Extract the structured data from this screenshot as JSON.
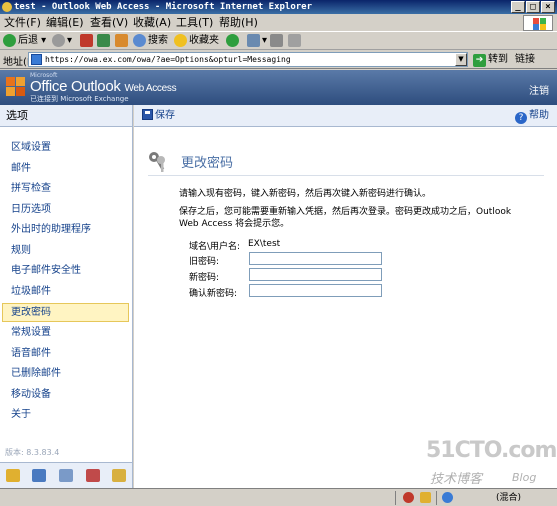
{
  "window": {
    "title": "test - Outlook Web Access - Microsoft Internet Explorer",
    "controls": [
      "_",
      "□",
      "×"
    ]
  },
  "menu": {
    "items": [
      "文件(F)",
      "编辑(E)",
      "查看(V)",
      "收藏(A)",
      "工具(T)",
      "帮助(H)"
    ]
  },
  "toolbar": {
    "back": "后退",
    "search": "搜索",
    "favorites": "收藏夹"
  },
  "address": {
    "label": "地址(D)",
    "url": "https://owa.ex.com/owa/?ae=Options&opturl=Messaging",
    "go": "转到",
    "links": "链接"
  },
  "owa": {
    "brand_small": "Microsoft",
    "brand_main": "Office Outlook",
    "brand_suffix": "Web Access",
    "connected": "已连接到 Microsoft Exchange",
    "logout": "注销"
  },
  "nav": {
    "header": "选项",
    "items": [
      {
        "label": "区域设置"
      },
      {
        "label": "邮件"
      },
      {
        "label": "拼写检查"
      },
      {
        "label": "日历选项"
      },
      {
        "label": "外出时的助理程序"
      },
      {
        "label": "规则"
      },
      {
        "label": "电子邮件安全性"
      },
      {
        "label": "垃圾邮件"
      },
      {
        "label": "更改密码"
      },
      {
        "label": "常规设置"
      },
      {
        "label": "语音邮件"
      },
      {
        "label": "已删除邮件"
      },
      {
        "label": "移动设备"
      },
      {
        "label": "关于"
      }
    ],
    "active_index": 8,
    "version": "版本: 8.3.83.4"
  },
  "commandbar": {
    "save": "保存",
    "help": "帮助"
  },
  "main": {
    "title": "更改密码",
    "instruction1": "请输入现有密码，键入新密码，然后再次键入新密码进行确认。",
    "instruction2": "保存之后，您可能需要重新输入凭据，然后再次登录。密码更改成功之后，Outlook Web Access 将会提示您。",
    "form": {
      "domain_label": "域名\\用户名:",
      "domain_value": "EX\\test",
      "old_label": "旧密码:",
      "new_label": "新密码:",
      "confirm_label": "确认新密码:"
    }
  },
  "status": {
    "zone": "(混合)"
  },
  "watermark": {
    "site": "51CTO.com",
    "sub": "技术博客",
    "blog": "Blog"
  },
  "colors": {
    "owa_header": "#2e4d7e",
    "nav_link": "#15428b",
    "title_blue": "#4a6fa5",
    "active_bg": "#fff4c2"
  }
}
